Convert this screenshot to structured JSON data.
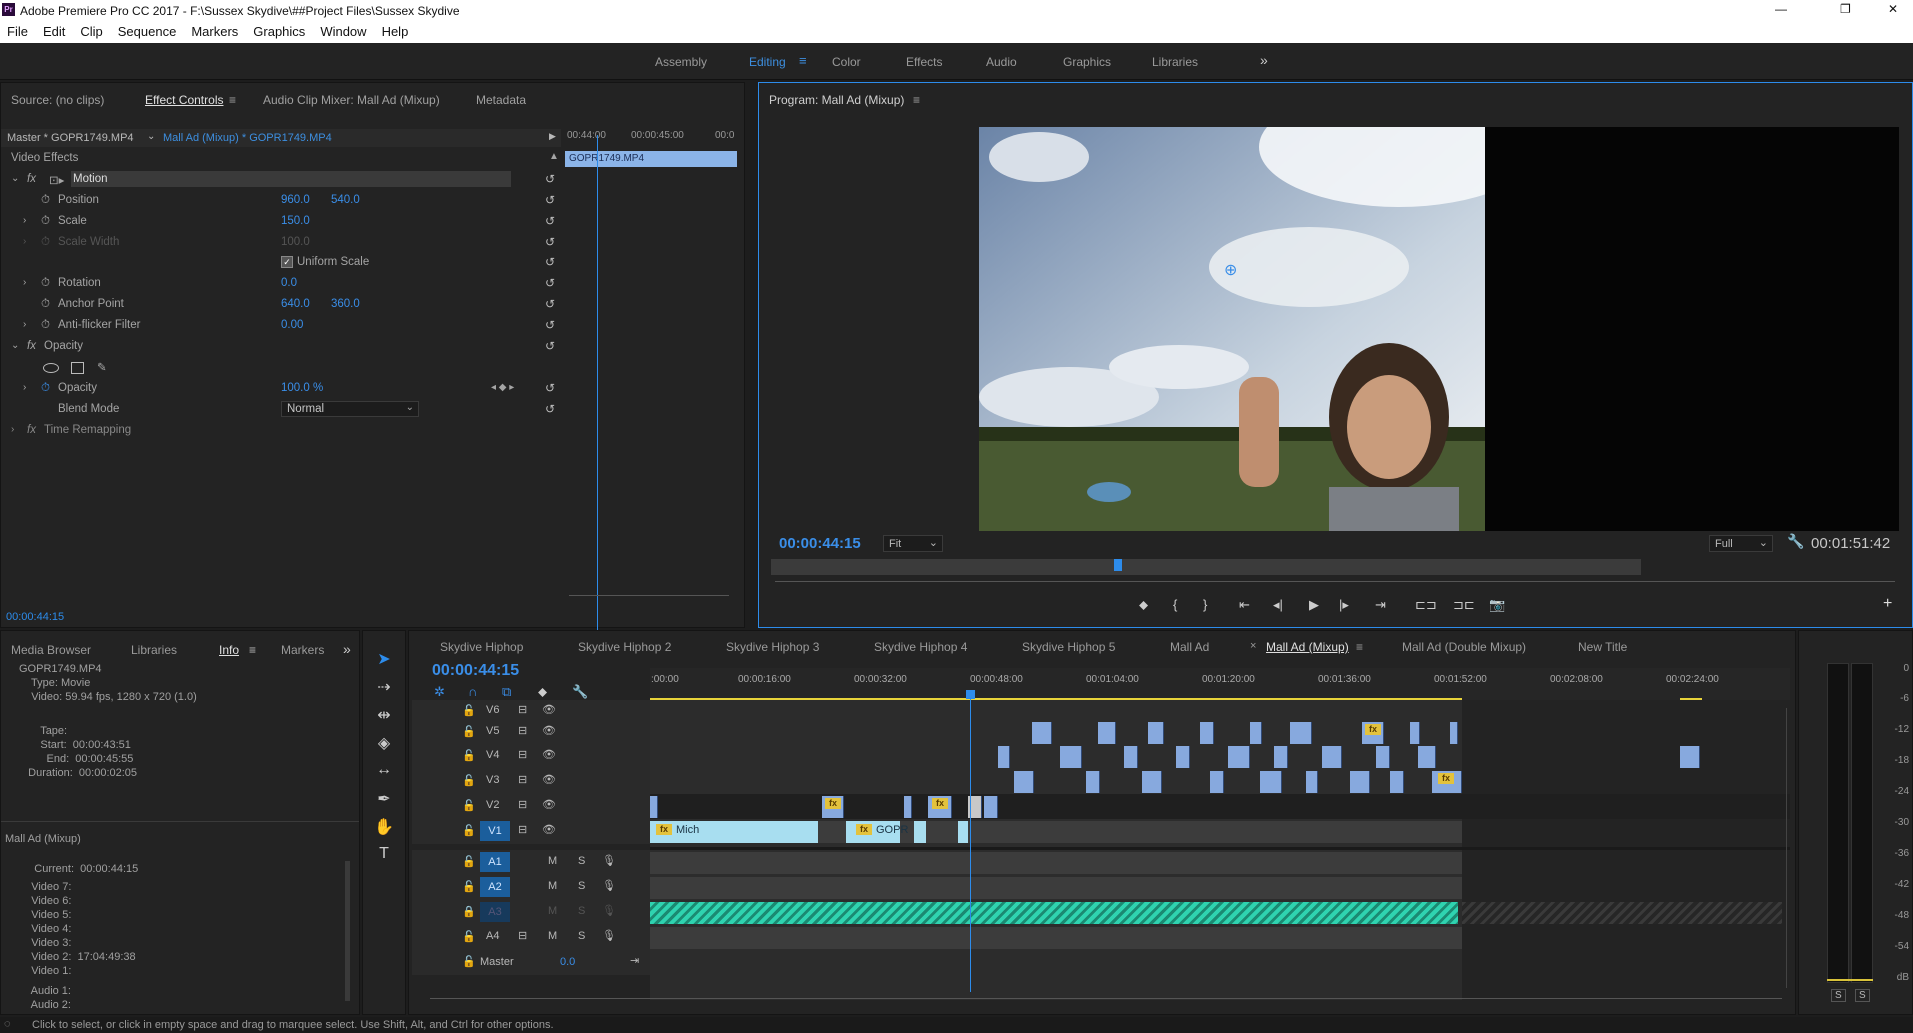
{
  "window": {
    "title": "Adobe Premiere Pro CC 2017 - F:\\Sussex Skydive\\##Project Files\\Sussex Skydive",
    "controls": [
      "—",
      "❐",
      "✕"
    ]
  },
  "menu": [
    "File",
    "Edit",
    "Clip",
    "Sequence",
    "Markers",
    "Graphics",
    "Window",
    "Help"
  ],
  "workspaces": [
    "Assembly",
    "Editing",
    "Color",
    "Effects",
    "Audio",
    "Graphics",
    "Libraries"
  ],
  "ws_active": "Editing",
  "ws_more": "»",
  "source_tabs": {
    "source": "Source: (no clips)",
    "effect_controls": "Effect Controls",
    "mixer": "Audio Clip Mixer: Mall Ad (Mixup)",
    "metadata": "Metadata"
  },
  "ec": {
    "master": "Master * GOPR1749.MP4",
    "seq": "Mall Ad (Mixup) * GOPR1749.MP4",
    "video_effects": "Video Effects",
    "motion": "Motion",
    "position": {
      "label": "Position",
      "x": "960.0",
      "y": "540.0"
    },
    "scale": {
      "label": "Scale",
      "v": "150.0"
    },
    "scale_width": {
      "label": "Scale Width",
      "v": "100.0"
    },
    "uniform": "Uniform Scale",
    "rotation": {
      "label": "Rotation",
      "v": "0.0"
    },
    "anchor": {
      "label": "Anchor Point",
      "x": "640.0",
      "y": "360.0"
    },
    "flicker": {
      "label": "Anti-flicker Filter",
      "v": "0.00"
    },
    "opacity_grp": "Opacity",
    "opacity": {
      "label": "Opacity",
      "v": "100.0 %"
    },
    "blend": {
      "label": "Blend Mode",
      "v": "Normal"
    },
    "time_remap": "Time Remapping",
    "mini_times": [
      "00:44:00",
      "00:00:45:00",
      "00:0"
    ],
    "mini_clip": "GOPR1749.MP4",
    "timecode": "00:00:44:15"
  },
  "program": {
    "title": "Program: Mall Ad (Mixup)",
    "timecode": "00:00:44:15",
    "fit": "Fit",
    "quality": "Full",
    "duration": "00:01:51:42"
  },
  "left_tabs": {
    "media": "Media Browser",
    "libraries": "Libraries",
    "info": "Info",
    "markers": "Markers",
    "more": "»"
  },
  "info": {
    "name": "GOPR1749.MP4",
    "type": "    Type: Movie",
    "video": "    Video: 59.94 fps, 1280 x 720 (1.0)",
    "tape": "       Tape:",
    "start": "       Start:  00:00:43:51",
    "end": "         End:  00:00:45:55",
    "duration": "   Duration:  00:00:02:05",
    "seq_name": "Mall Ad (Mixup)",
    "current": "     Current:  00:00:44:15",
    "tracks": [
      "    Video 7:",
      "    Video 6:",
      "    Video 5:",
      "    Video 4:",
      "    Video 3:",
      "    Video 2:  17:04:49:38",
      "    Video 1:"
    ],
    "audio": [
      "    Audio 1:",
      "    Audio 2:"
    ]
  },
  "seq_tabs": [
    "Skydive Hiphop",
    "Skydive Hiphop 2",
    "Skydive Hiphop 3",
    "Skydive Hiphop 4",
    "Skydive Hiphop 5",
    "Mall Ad",
    "Mall Ad (Mixup)",
    "Mall Ad (Double Mixup)",
    "New Title"
  ],
  "seq_active": "Mall Ad (Mixup)",
  "timeline": {
    "timecode": "00:00:44:15",
    "ruler": [
      ":00:00",
      "00:00:16:00",
      "00:00:32:00",
      "00:00:48:00",
      "00:01:04:00",
      "00:01:20:00",
      "00:01:36:00",
      "00:01:52:00",
      "00:02:08:00",
      "00:02:24:00"
    ],
    "video_tracks": [
      "V6",
      "V5",
      "V4",
      "V3",
      "V2",
      "V1"
    ],
    "audio_tracks": [
      "A1",
      "A2",
      "A3",
      "A4"
    ],
    "master": "Master",
    "master_val": "0.0",
    "clip_v1a": "Mich",
    "clip_v1b": "GOPR",
    "fx": "fx"
  },
  "meter": {
    "scale": [
      "0",
      "-6",
      "-12",
      "-18",
      "-24",
      "-30",
      "-36",
      "-42",
      "-48",
      "-54",
      "dB"
    ],
    "solo": "S"
  },
  "status": "Click to select, or click in empty space and drag to marquee select. Use Shift, Alt, and Ctrl for other options.",
  "colors": {
    "accent": "#2d8ceb",
    "clip_blue": "#87a9de",
    "clip_light": "#a8def0",
    "audio_green": "#2fd3b0",
    "fx_yellow": "#e3c23c"
  }
}
